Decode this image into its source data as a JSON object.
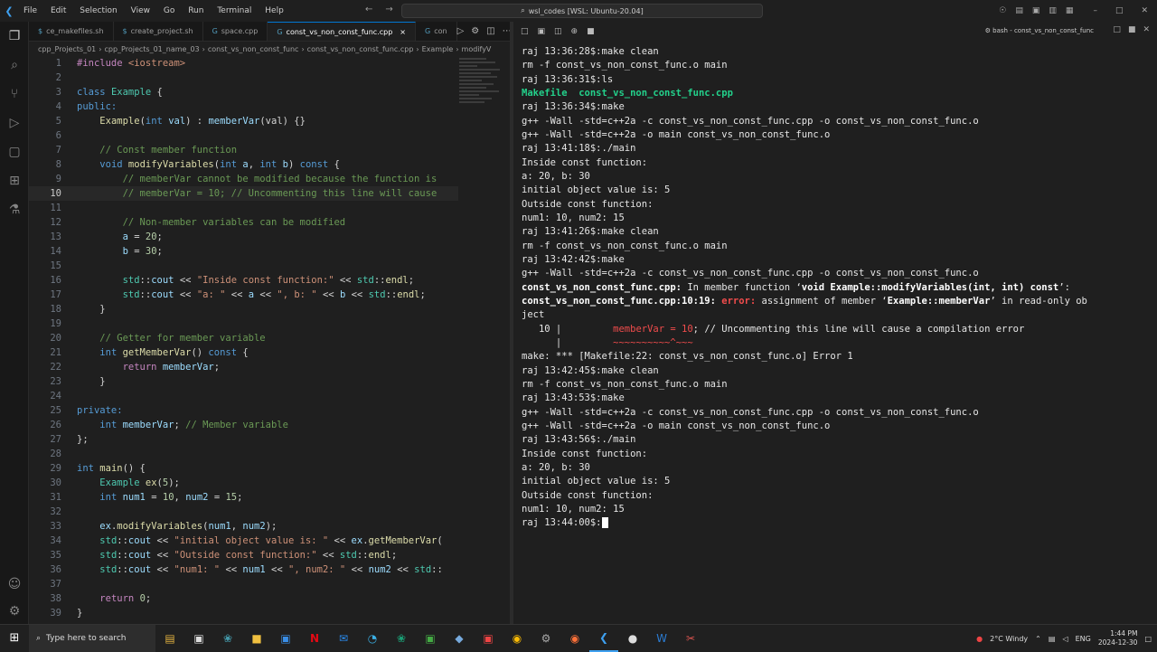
{
  "titlebar": {
    "menu": [
      "File",
      "Edit",
      "Selection",
      "View",
      "Go",
      "Run",
      "Terminal",
      "Help"
    ],
    "search": "wsl_codes [WSL: Ubuntu-20.04]"
  },
  "tabs": [
    {
      "label": "ce_makefiles.sh",
      "icon": "shell-file-icon"
    },
    {
      "label": "create_project.sh",
      "icon": "shell-file-icon"
    },
    {
      "label": "space.cpp",
      "icon": "cpp-file-icon"
    },
    {
      "label": "const_vs_non_const_func.cpp",
      "icon": "cpp-file-icon",
      "active": true,
      "close": "×"
    },
    {
      "label": "con",
      "icon": "cpp-file-icon"
    }
  ],
  "breadcrumb": [
    "cpp_Projects_01",
    "cpp_Projects_01_name_03",
    "const_vs_non_const_func",
    "const_vs_non_const_func.cpp",
    "Example",
    "modifyV"
  ],
  "code": {
    "current_line": 10,
    "lines": [
      {
        "n": "1",
        "html": "<span class='pp'>#include</span> <span class='st'>&lt;iostream&gt;</span>"
      },
      {
        "n": "2",
        "html": ""
      },
      {
        "n": "3",
        "html": "<span class='kw'>class</span> <span class='ty'>Example</span> <span class='pl'>{</span>"
      },
      {
        "n": "4",
        "html": "<span class='kw'>public:</span>"
      },
      {
        "n": "5",
        "html": "    <span class='fn'>Example</span><span class='pl'>(</span><span class='kw'>int</span> <span class='va'>val</span><span class='pl'>) : </span><span class='va'>memberVar</span><span class='pl'>(val) {}</span>"
      },
      {
        "n": "6",
        "html": ""
      },
      {
        "n": "7",
        "html": "    <span class='cm'>// Const member function</span>"
      },
      {
        "n": "8",
        "html": "    <span class='kw'>void</span> <span class='fn'>modifyVariables</span><span class='pl'>(</span><span class='kw'>int</span> <span class='va'>a</span><span class='pl'>, </span><span class='kw'>int</span> <span class='va'>b</span><span class='pl'>) </span><span class='kw'>const</span> <span class='pl'>{</span>"
      },
      {
        "n": "9",
        "html": "        <span class='cm'>// memberVar cannot be modified because the function is</span>"
      },
      {
        "n": "10",
        "html": "        <span class='cm'>// memberVar = 10; // Uncommenting this line will cause</span>"
      },
      {
        "n": "11",
        "html": ""
      },
      {
        "n": "12",
        "html": "        <span class='cm'>// Non-member variables can be modified</span>"
      },
      {
        "n": "13",
        "html": "        <span class='va'>a</span> <span class='pl'>=</span> <span class='nu'>20</span><span class='pl'>;</span>"
      },
      {
        "n": "14",
        "html": "        <span class='va'>b</span> <span class='pl'>=</span> <span class='nu'>30</span><span class='pl'>;</span>"
      },
      {
        "n": "15",
        "html": ""
      },
      {
        "n": "16",
        "html": "        <span class='ty'>std</span><span class='pl'>::</span><span class='va'>cout</span> <span class='pl'>&lt;&lt;</span> <span class='st'>\"Inside const function:\"</span> <span class='pl'>&lt;&lt;</span> <span class='ty'>std</span><span class='pl'>::</span><span class='fn'>endl</span><span class='pl'>;</span>"
      },
      {
        "n": "17",
        "html": "        <span class='ty'>std</span><span class='pl'>::</span><span class='va'>cout</span> <span class='pl'>&lt;&lt;</span> <span class='st'>\"a: \"</span> <span class='pl'>&lt;&lt;</span> <span class='va'>a</span> <span class='pl'>&lt;&lt;</span> <span class='st'>\", b: \"</span> <span class='pl'>&lt;&lt;</span> <span class='va'>b</span> <span class='pl'>&lt;&lt;</span> <span class='ty'>std</span><span class='pl'>::</span><span class='fn'>endl</span><span class='pl'>;</span>"
      },
      {
        "n": "18",
        "html": "    <span class='pl'>}</span>"
      },
      {
        "n": "19",
        "html": ""
      },
      {
        "n": "20",
        "html": "    <span class='cm'>// Getter for member variable</span>"
      },
      {
        "n": "21",
        "html": "    <span class='kw'>int</span> <span class='fn'>getMemberVar</span><span class='pl'>() </span><span class='kw'>const</span> <span class='pl'>{</span>"
      },
      {
        "n": "22",
        "html": "        <span class='pp'>return</span> <span class='va'>memberVar</span><span class='pl'>;</span>"
      },
      {
        "n": "23",
        "html": "    <span class='pl'>}</span>"
      },
      {
        "n": "24",
        "html": ""
      },
      {
        "n": "25",
        "html": "<span class='kw'>private:</span>"
      },
      {
        "n": "26",
        "html": "    <span class='kw'>int</span> <span class='va'>memberVar</span><span class='pl'>;</span> <span class='cm'>// Member variable</span>"
      },
      {
        "n": "27",
        "html": "<span class='pl'>};</span>"
      },
      {
        "n": "28",
        "html": ""
      },
      {
        "n": "29",
        "html": "<span class='kw'>int</span> <span class='fn'>main</span><span class='pl'>() {</span>"
      },
      {
        "n": "30",
        "html": "    <span class='ty'>Example</span> <span class='fn'>ex</span><span class='pl'>(</span><span class='nu'>5</span><span class='pl'>);</span>"
      },
      {
        "n": "31",
        "html": "    <span class='kw'>int</span> <span class='va'>num1</span> <span class='pl'>=</span> <span class='nu'>10</span><span class='pl'>, </span><span class='va'>num2</span> <span class='pl'>=</span> <span class='nu'>15</span><span class='pl'>;</span>"
      },
      {
        "n": "32",
        "html": ""
      },
      {
        "n": "33",
        "html": "    <span class='va'>ex</span><span class='pl'>.</span><span class='fn'>modifyVariables</span><span class='pl'>(</span><span class='va'>num1</span><span class='pl'>, </span><span class='va'>num2</span><span class='pl'>);</span>"
      },
      {
        "n": "34",
        "html": "    <span class='ty'>std</span><span class='pl'>::</span><span class='va'>cout</span> <span class='pl'>&lt;&lt;</span> <span class='st'>\"initial object value is: \"</span> <span class='pl'>&lt;&lt;</span> <span class='va'>ex</span><span class='pl'>.</span><span class='fn'>getMemberVar</span><span class='pl'>(</span>"
      },
      {
        "n": "35",
        "html": "    <span class='ty'>std</span><span class='pl'>::</span><span class='va'>cout</span> <span class='pl'>&lt;&lt;</span> <span class='st'>\"Outside const function:\"</span> <span class='pl'>&lt;&lt;</span> <span class='ty'>std</span><span class='pl'>::</span><span class='fn'>endl</span><span class='pl'>;</span>"
      },
      {
        "n": "36",
        "html": "    <span class='ty'>std</span><span class='pl'>::</span><span class='va'>cout</span> <span class='pl'>&lt;&lt;</span> <span class='st'>\"num1: \"</span> <span class='pl'>&lt;&lt;</span> <span class='va'>num1</span> <span class='pl'>&lt;&lt;</span> <span class='st'>\", num2: \"</span> <span class='pl'>&lt;&lt;</span> <span class='va'>num2</span> <span class='pl'>&lt;&lt;</span> <span class='ty'>std</span><span class='pl'>::</span>"
      },
      {
        "n": "37",
        "html": ""
      },
      {
        "n": "38",
        "html": "    <span class='pp'>return</span> <span class='nu'>0</span><span class='pl'>;</span>"
      },
      {
        "n": "39",
        "html": "<span class='pl'>}</span>"
      }
    ]
  },
  "terminal": {
    "title": "bash - const_vs_non_const_func",
    "lines": [
      {
        "html": "raj 13:36:28$:make clean"
      },
      {
        "html": "rm -f const_vs_non_const_func.o main"
      },
      {
        "html": "raj 13:36:31$:ls"
      },
      {
        "html": "<span class='t-green'>Makefile  const_vs_non_const_func.cpp</span>"
      },
      {
        "html": "raj 13:36:34$:make"
      },
      {
        "html": "g++ -Wall -std=c++2a -c const_vs_non_const_func.cpp -o const_vs_non_const_func.o"
      },
      {
        "html": "g++ -Wall -std=c++2a -o main const_vs_non_const_func.o"
      },
      {
        "html": "raj 13:41:18$:./main"
      },
      {
        "html": "Inside const function:"
      },
      {
        "html": "a: 20, b: 30"
      },
      {
        "html": "initial object value is: 5"
      },
      {
        "html": "Outside const function:"
      },
      {
        "html": "num1: 10, num2: 15"
      },
      {
        "html": "raj 13:41:26$:make clean"
      },
      {
        "html": "rm -f const_vs_non_const_func.o main"
      },
      {
        "html": "raj 13:42:42$:make"
      },
      {
        "html": "g++ -Wall -std=c++2a -c const_vs_non_const_func.cpp -o const_vs_non_const_func.o"
      },
      {
        "html": "<span class='t-bold'>const_vs_non_const_func.cpp:</span> In member function ‘<span class='t-bold'>void Example::modifyVariables(int, int) const</span>’:"
      },
      {
        "html": "<span class='t-bold'>const_vs_non_const_func.cpp:10:19:</span> <span class='t-red'>error:</span> assignment of member ‘<span class='t-bold'>Example::memberVar</span>’ in read-only ob"
      },
      {
        "html": "ject"
      },
      {
        "html": "   10 |         <span class='t-err'>memberVar = 10</span>; // Uncommenting this line will cause a compilation error"
      },
      {
        "html": "      |         <span class='t-tilde'>~~~~~~~~~~^~~~</span>"
      },
      {
        "html": "make: *** [Makefile:22: const_vs_non_const_func.o] Error 1"
      },
      {
        "html": "raj 13:42:45$:make clean"
      },
      {
        "html": "rm -f const_vs_non_const_func.o main"
      },
      {
        "html": "raj 13:43:53$:make"
      },
      {
        "html": "g++ -Wall -std=c++2a -c const_vs_non_const_func.cpp -o const_vs_non_const_func.o"
      },
      {
        "html": "g++ -Wall -std=c++2a -o main const_vs_non_const_func.o"
      },
      {
        "html": "raj 13:43:56$:./main"
      },
      {
        "html": "Inside const function:"
      },
      {
        "html": "a: 20, b: 30"
      },
      {
        "html": "initial object value is: 5"
      },
      {
        "html": "Outside const function:"
      },
      {
        "html": "num1: 10, num2: 15"
      },
      {
        "html": "raj 13:44:00$:<span class='cursor'></span>"
      }
    ]
  },
  "taskbar": {
    "search_placeholder": "Type here to search",
    "weather": "2°C  Windy",
    "lang": "ENG",
    "time": "1:44 PM",
    "date": "2024-12-30"
  }
}
